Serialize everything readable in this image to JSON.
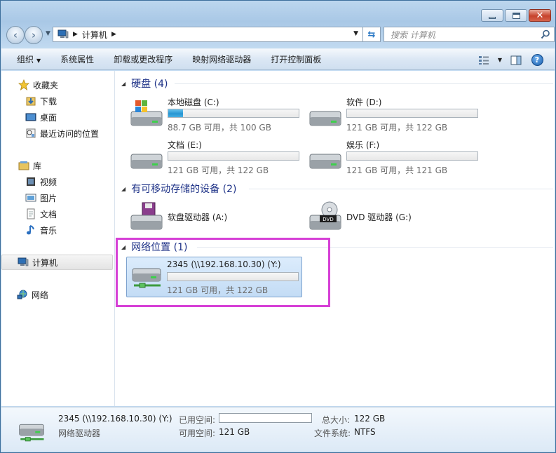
{
  "address": {
    "location": "计算机"
  },
  "search": {
    "placeholder": "搜索 计算机"
  },
  "toolbar": {
    "organize": "组织",
    "system_properties": "系统属性",
    "uninstall": "卸载或更改程序",
    "map_drive": "映射网络驱动器",
    "control_panel": "打开控制面板"
  },
  "sidebar": {
    "favorites": "收藏夹",
    "downloads": "下载",
    "desktop": "桌面",
    "recent": "最近访问的位置",
    "libraries": "库",
    "videos": "视频",
    "pictures": "图片",
    "documents": "文档",
    "music": "音乐",
    "computer": "计算机",
    "network": "网络"
  },
  "groups": {
    "hdd": "硬盘 (4)",
    "removable": "有可移动存储的设备 (2)",
    "network": "网络位置 (1)"
  },
  "drives": {
    "c": {
      "name": "本地磁盘 (C:)",
      "info": "88.7 GB 可用，共 100 GB",
      "used_fraction": 0.113
    },
    "d": {
      "name": "软件 (D:)",
      "info": "121 GB 可用，共 122 GB",
      "used_fraction": 0.0
    },
    "e": {
      "name": "文档 (E:)",
      "info": "121 GB 可用，共 122 GB",
      "used_fraction": 0.0
    },
    "f": {
      "name": "娱乐 (F:)",
      "info": "121 GB 可用，共 121 GB",
      "used_fraction": 0.0
    }
  },
  "removable": {
    "a": {
      "name": "软盘驱动器 (A:)"
    },
    "g": {
      "name": "DVD 驱动器 (G:)"
    }
  },
  "network_drive": {
    "name": "2345 (\\\\192.168.10.30) (Y:)",
    "info": "121 GB 可用，共 122 GB",
    "used_fraction": 0.0
  },
  "details": {
    "name": "2345 (\\\\192.168.10.30) (Y:)",
    "type": "网络驱动器",
    "used_label": "已用空间:",
    "free_label": "可用空间:",
    "free_value": "121 GB",
    "total_label": "总大小:",
    "total_value": "122 GB",
    "fs_label": "文件系统:",
    "fs_value": "NTFS"
  },
  "colors": {
    "accent": "#1e3287",
    "highlight": "#d640d6",
    "bar_fill": "#2695d3"
  },
  "icons": [
    "minimize-icon",
    "maximize-icon",
    "close-icon",
    "back-icon",
    "forward-icon",
    "computer-icon",
    "refresh-icon",
    "search-icon",
    "star-icon",
    "folder-icon",
    "hard-drive-icon",
    "floppy-drive-icon",
    "dvd-drive-icon",
    "network-drive-icon",
    "help-icon"
  ]
}
